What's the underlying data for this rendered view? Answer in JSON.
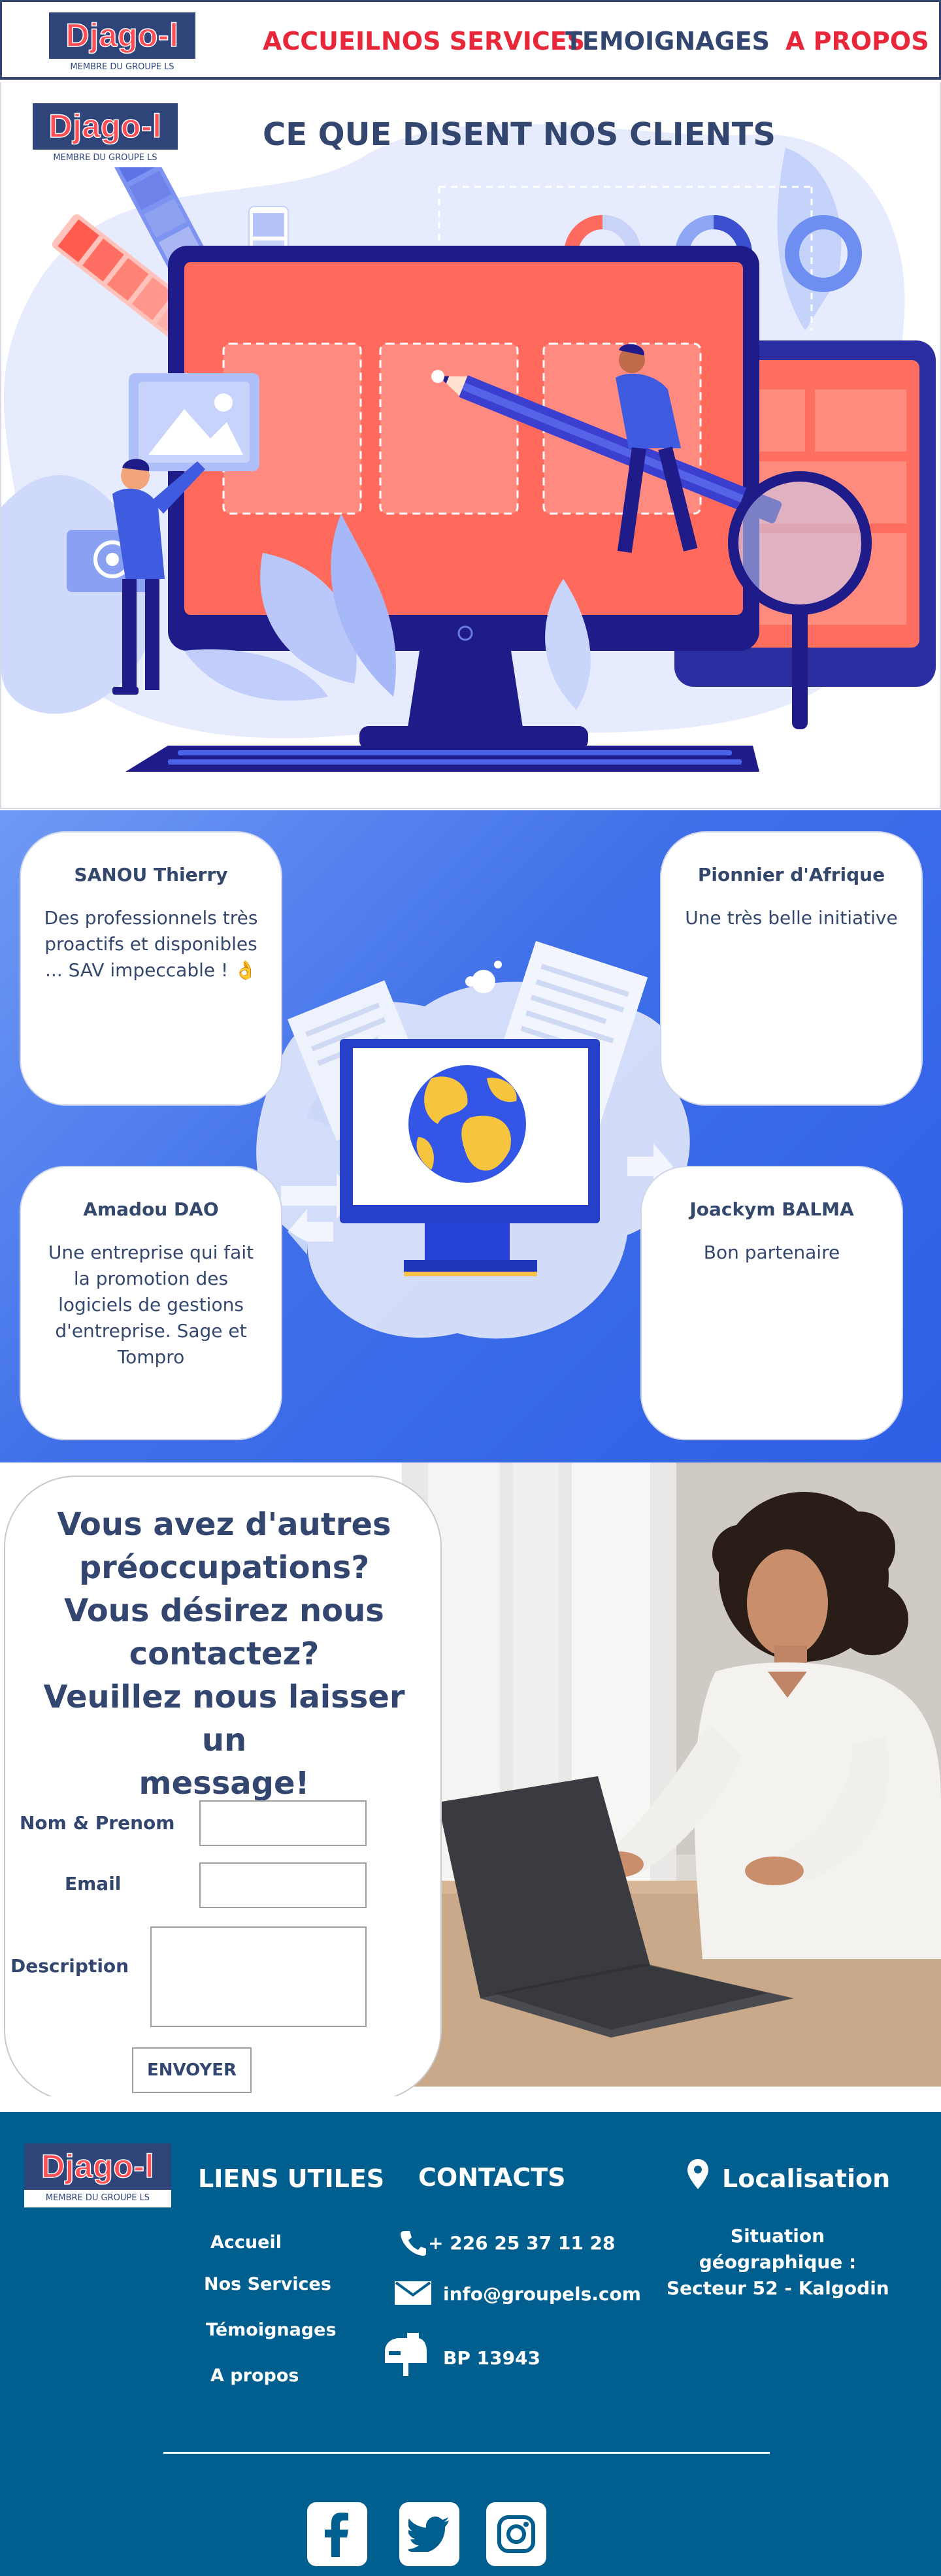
{
  "brand": {
    "name": "Djago-l",
    "tagline": "MEMBRE DU GROUPE LS",
    "name_color": "#ff4e55",
    "plate_color": "#2f4579"
  },
  "nav": {
    "items": [
      {
        "label": "ACCUEIL",
        "color": "#e8283a"
      },
      {
        "label": "NOS SERVICES",
        "color": "#e8283a"
      },
      {
        "label": "TEMOIGNAGES",
        "color": "#33466f"
      },
      {
        "label": "A PROPOS",
        "color": "#e8283a"
      }
    ]
  },
  "hero": {
    "title": "CE QUE DISENT NOS CLIENTS",
    "illustration_icon": "web-design-illustration"
  },
  "testimonials": [
    {
      "name": "SANOU Thierry",
      "text": "Des professionnels très proactifs et disponibles ... SAV impeccable ! 👌"
    },
    {
      "name": "Pionnier d'Afrique",
      "text": "Une très belle initiative"
    },
    {
      "name": "Amadou DAO",
      "text": "Une entreprise qui fait la promotion des logiciels de gestions d'entreprise. Sage et Tompro"
    },
    {
      "name": "Joackym BALMA",
      "text": "Bon partenaire"
    }
  ],
  "contact": {
    "title_lines": [
      "Vous avez d'autres",
      "préoccupations?",
      "Vous désirez nous",
      "contactez?",
      "Veuillez nous laisser un",
      "message!"
    ],
    "fields": {
      "name_label": "Nom & Prenom",
      "name_value": "",
      "email_label": "Email",
      "email_value": "",
      "description_label": "Description",
      "description_value": ""
    },
    "submit_label": "ENVOYER"
  },
  "footer": {
    "links_title": "LIENS UTILES",
    "links": [
      "Accueil",
      "Nos Services",
      "Témoignages",
      "A propos"
    ],
    "contacts_title": "CONTACTS",
    "phone": "+ 226 25 37 11 28",
    "email": "info@groupels.com",
    "po_box": "BP 13943",
    "location_title": "Localisation",
    "location_lines": [
      "Situation",
      "géographique :",
      "Secteur 52 - Kalgodin"
    ],
    "social": [
      "facebook-icon",
      "twitter-icon",
      "instagram-icon"
    ],
    "bg_color": "#005f8e"
  }
}
